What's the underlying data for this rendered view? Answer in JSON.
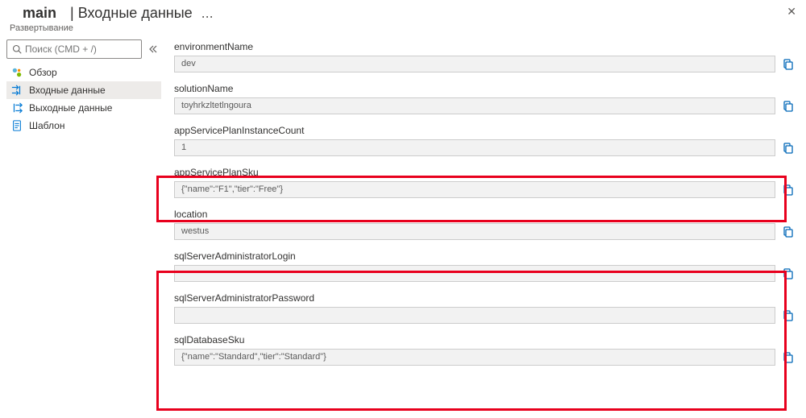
{
  "header": {
    "title_main": "main",
    "title_sep": " | ",
    "title_rest": "Входные данные",
    "more": "...",
    "subtitle": "Развертывание"
  },
  "search": {
    "placeholder": "Поиск (CMD + /)"
  },
  "sidebar": {
    "items": [
      {
        "label": "Обзор"
      },
      {
        "label": "Входные данные",
        "active": true
      },
      {
        "label": "Выходные данные"
      },
      {
        "label": "Шаблон"
      }
    ]
  },
  "fields": [
    {
      "label": "environmentName",
      "value": "dev"
    },
    {
      "label": "solutionName",
      "value": "toyhrkzltetlngoura"
    },
    {
      "label": "appServicePlanInstanceCount",
      "value": "1"
    },
    {
      "label": "appServicePlanSku",
      "value": "{\"name\":\"F1\",\"tier\":\"Free\"}"
    },
    {
      "label": "location",
      "value": "westus"
    },
    {
      "label": "sqlServerAdministratorLogin",
      "value": ""
    },
    {
      "label": "sqlServerAdministratorPassword",
      "value": ""
    },
    {
      "label": "sqlDatabaseSku",
      "value": "{\"name\":\"Standard\",\"tier\":\"Standard\"}"
    }
  ]
}
